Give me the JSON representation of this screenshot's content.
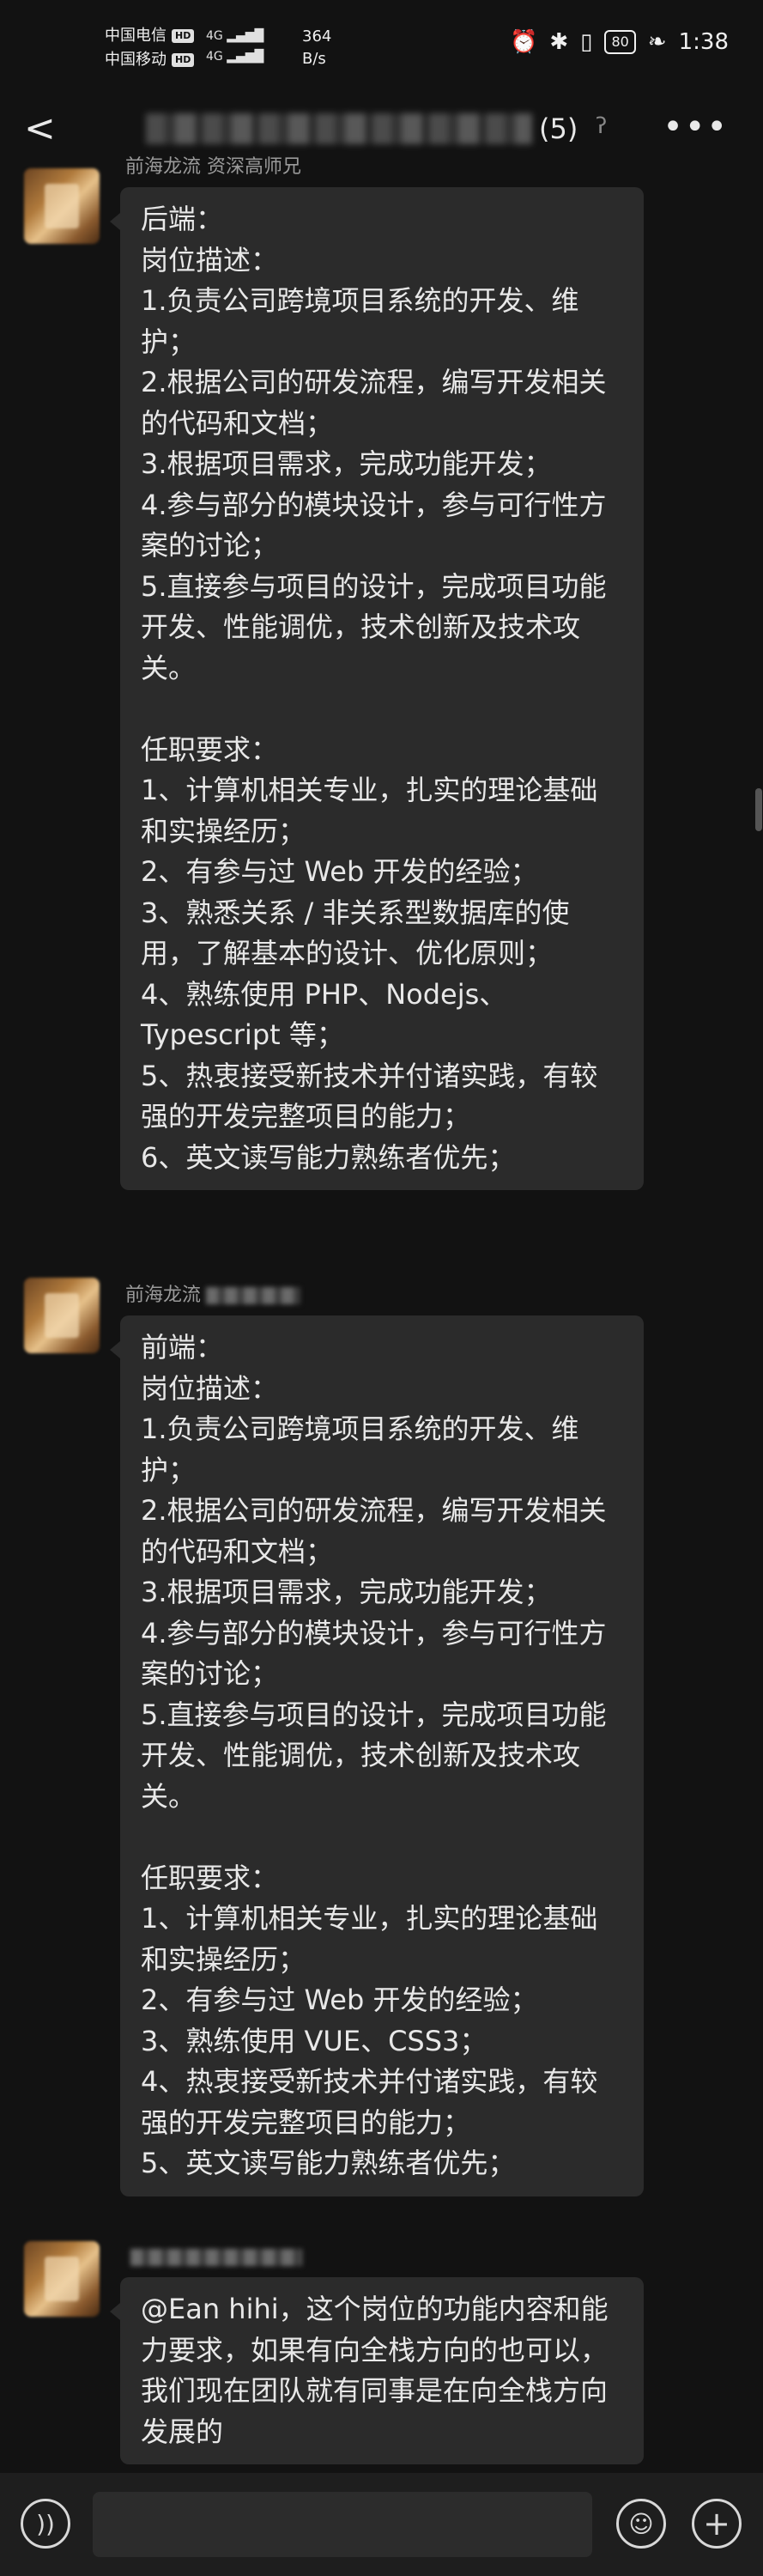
{
  "status_bar": {
    "carrier1": "中国电信",
    "carrier2": "中国移动",
    "hd": "HD",
    "net1": "4G",
    "net2": "4G",
    "speed_value": "364",
    "speed_unit": "B/s",
    "battery": "80",
    "time": "1:38"
  },
  "header": {
    "back_label": "<",
    "member_count": "(5)",
    "more_label": "•••"
  },
  "messages": [
    {
      "sender": "前海龙流 资深高师兄",
      "text": "后端：\n岗位描述：\n1.负责公司跨境项目系统的开发、维护；\n2.根据公司的研发流程，编写开发相关的代码和文档；\n3.根据项目需求，完成功能开发；\n4.参与部分的模块设计，参与可行性方案的讨论；\n5.直接参与项目的设计，完成项目功能开发、性能调优，技术创新及技术攻关。\n\n任职要求：\n1、计算机相关专业，扎实的理论基础和实操经历；\n2、有参与过 Web 开发的经验；\n3、熟悉关系 / 非关系型数据库的使用，了解基本的设计、优化原则；\n4、熟练使用 PHP、Nodejs、Typescript 等；\n5、热衷接受新技术并付诸实践，有较强的开发完整项目的能力；\n6、英文读写能力熟练者优先；"
    },
    {
      "sender": "前海龙流",
      "text": "前端：\n岗位描述：\n1.负责公司跨境项目系统的开发、维护；\n2.根据公司的研发流程，编写开发相关的代码和文档；\n3.根据项目需求，完成功能开发；\n4.参与部分的模块设计，参与可行性方案的讨论；\n5.直接参与项目的设计，完成项目功能开发、性能调优，技术创新及技术攻关。\n\n任职要求：\n1、计算机相关专业，扎实的理论基础和实操经历；\n2、有参与过 Web 开发的经验；\n3、熟练使用 VUE、CSS3；\n4、热衷接受新技术并付诸实践，有较强的开发完整项目的能力；\n5、英文读写能力熟练者优先；"
    },
    {
      "sender": "",
      "text": "@Ean hihi，这个岗位的功能内容和能力要求，如果有向全栈方向的也可以，我们现在团队就有同事是在向全栈方向发展的"
    }
  ],
  "input_bar": {
    "placeholder": "",
    "voice_icon": "voice-icon",
    "emoji_icon": "emoji-icon",
    "plus_icon": "plus-icon"
  }
}
